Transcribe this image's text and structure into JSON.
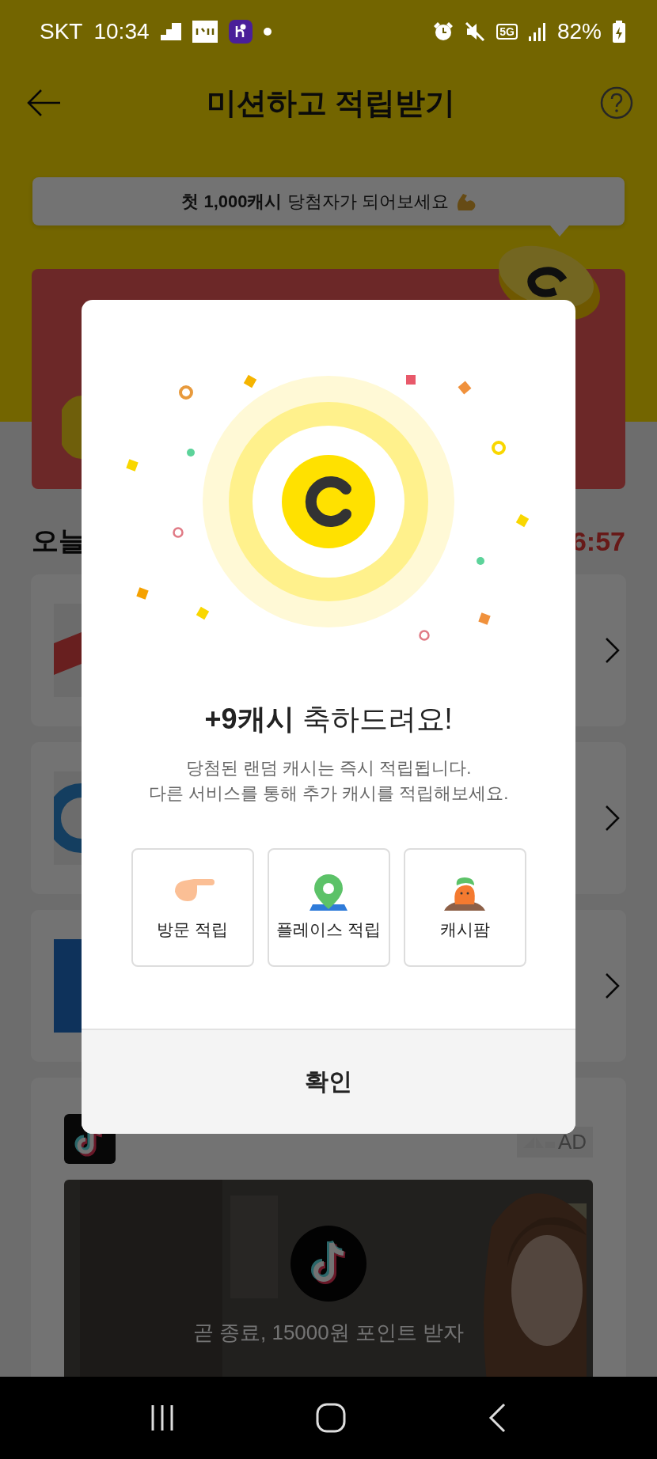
{
  "status_bar": {
    "carrier": "SKT",
    "time": "10:34",
    "network": "5G",
    "battery": "82%"
  },
  "header": {
    "title": "미션하고 적립받기"
  },
  "banner": {
    "text": "**첫 1,000캐시** 당첨자가 되어보세요"
  },
  "promo_card": {
    "coins": true
  },
  "section": {
    "title": "오늘",
    "timer": "6:57"
  },
  "missions": [
    {
      "kind": "tag"
    },
    {
      "kind": "circle"
    },
    {
      "kind": "square"
    }
  ],
  "ad": {
    "badge": "AD",
    "caption": "곧 종료, 15000원 포인트 받자"
  },
  "dialog": {
    "title": "**+9캐시** 축하드려요!",
    "message": [
      "당첨된 랜덤 캐시는 즉시 적립됩니다.",
      "다른 서비스를 통해 추가 캐시를 적립해보세요."
    ],
    "shortcuts": [
      {
        "kind": "hand",
        "label": "방문 적립"
      },
      {
        "kind": "pin",
        "label": "플레이스 적립"
      },
      {
        "kind": "carrot",
        "label": "캐시팜"
      }
    ],
    "confirm": "확인"
  }
}
